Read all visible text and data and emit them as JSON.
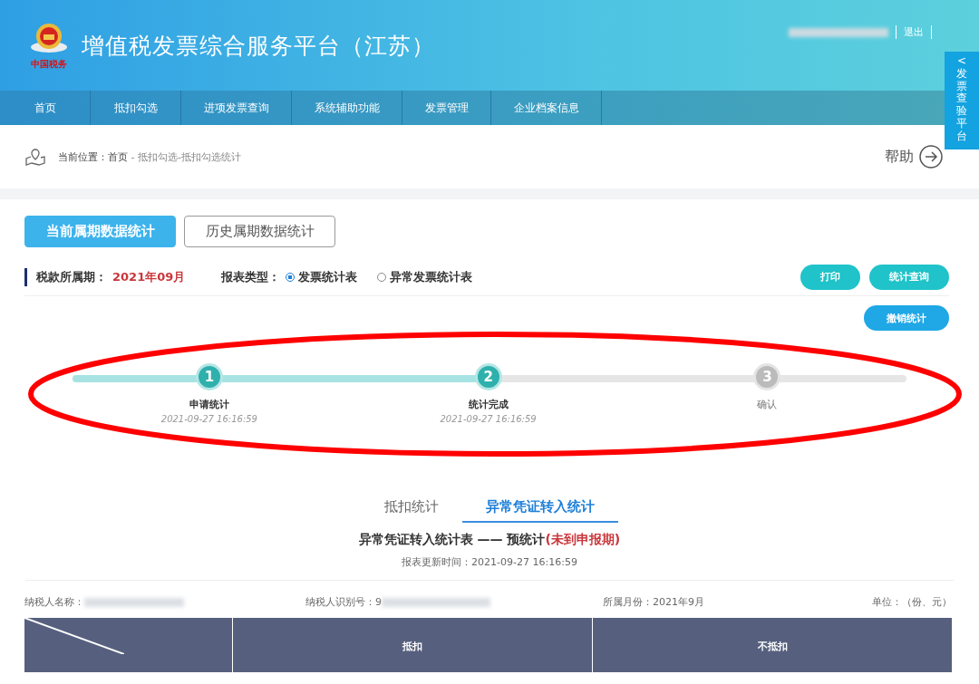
{
  "header": {
    "title": "增值税发票综合服务平台（江苏）",
    "logo_text": "中国税务",
    "logout": "退出",
    "side_tab": {
      "arrow": "<",
      "label": "发票查验平台"
    }
  },
  "nav": [
    {
      "label": "首页"
    },
    {
      "label": "抵扣勾选"
    },
    {
      "label": "进项发票查询"
    },
    {
      "label": "系统辅助功能"
    },
    {
      "label": "发票管理"
    },
    {
      "label": "企业档案信息"
    }
  ],
  "breadcrumb": {
    "prefix": "当前位置：",
    "home": "首页",
    "path": "- 抵扣勾选-抵扣勾选统计",
    "help": "帮助"
  },
  "tabs": [
    {
      "label": "当前属期数据统计",
      "selected": true
    },
    {
      "label": "历史属期数据统计",
      "selected": false
    }
  ],
  "period": {
    "label": "税款所属期：",
    "value": "2021年09月"
  },
  "report_type": {
    "label": "报表类型：",
    "options": [
      {
        "label": "发票统计表",
        "selected": true
      },
      {
        "label": "异常发票统计表",
        "selected": false
      }
    ]
  },
  "actions": [
    {
      "label": "打印",
      "kind": "teal"
    },
    {
      "label": "统计查询",
      "kind": "teal"
    }
  ],
  "cancel_button": {
    "label": "撤销统计",
    "kind": "blue"
  },
  "progress": {
    "level": 0.5
  },
  "steps": [
    {
      "number": "1",
      "label": "申请统计",
      "time": "2021-09-27 16:16:59",
      "done": true
    },
    {
      "number": "2",
      "label": "统计完成",
      "time": "2021-09-27 16:16:59",
      "done": true
    },
    {
      "number": "3",
      "label": "确认",
      "done": false
    }
  ],
  "annotation": {
    "circled": true
  },
  "sub_tabs": [
    {
      "label": "抵扣统计",
      "selected": false
    },
    {
      "label": "异常凭证转入统计",
      "selected": true
    }
  ],
  "report": {
    "title": "异常凭证转入统计表 —— 预统计",
    "status": "(未到申报期)",
    "updated": "报表更新时间：2021-09-27 16:16:59"
  },
  "info": {
    "taxpayer_name": "纳税人名称：",
    "taxpayer_id": "纳税人识别号：9",
    "month": "所属月份：2021年9月",
    "unit": "单位：（份、元）"
  },
  "table": {
    "columns": [
      "抵扣",
      "不抵扣"
    ]
  }
}
